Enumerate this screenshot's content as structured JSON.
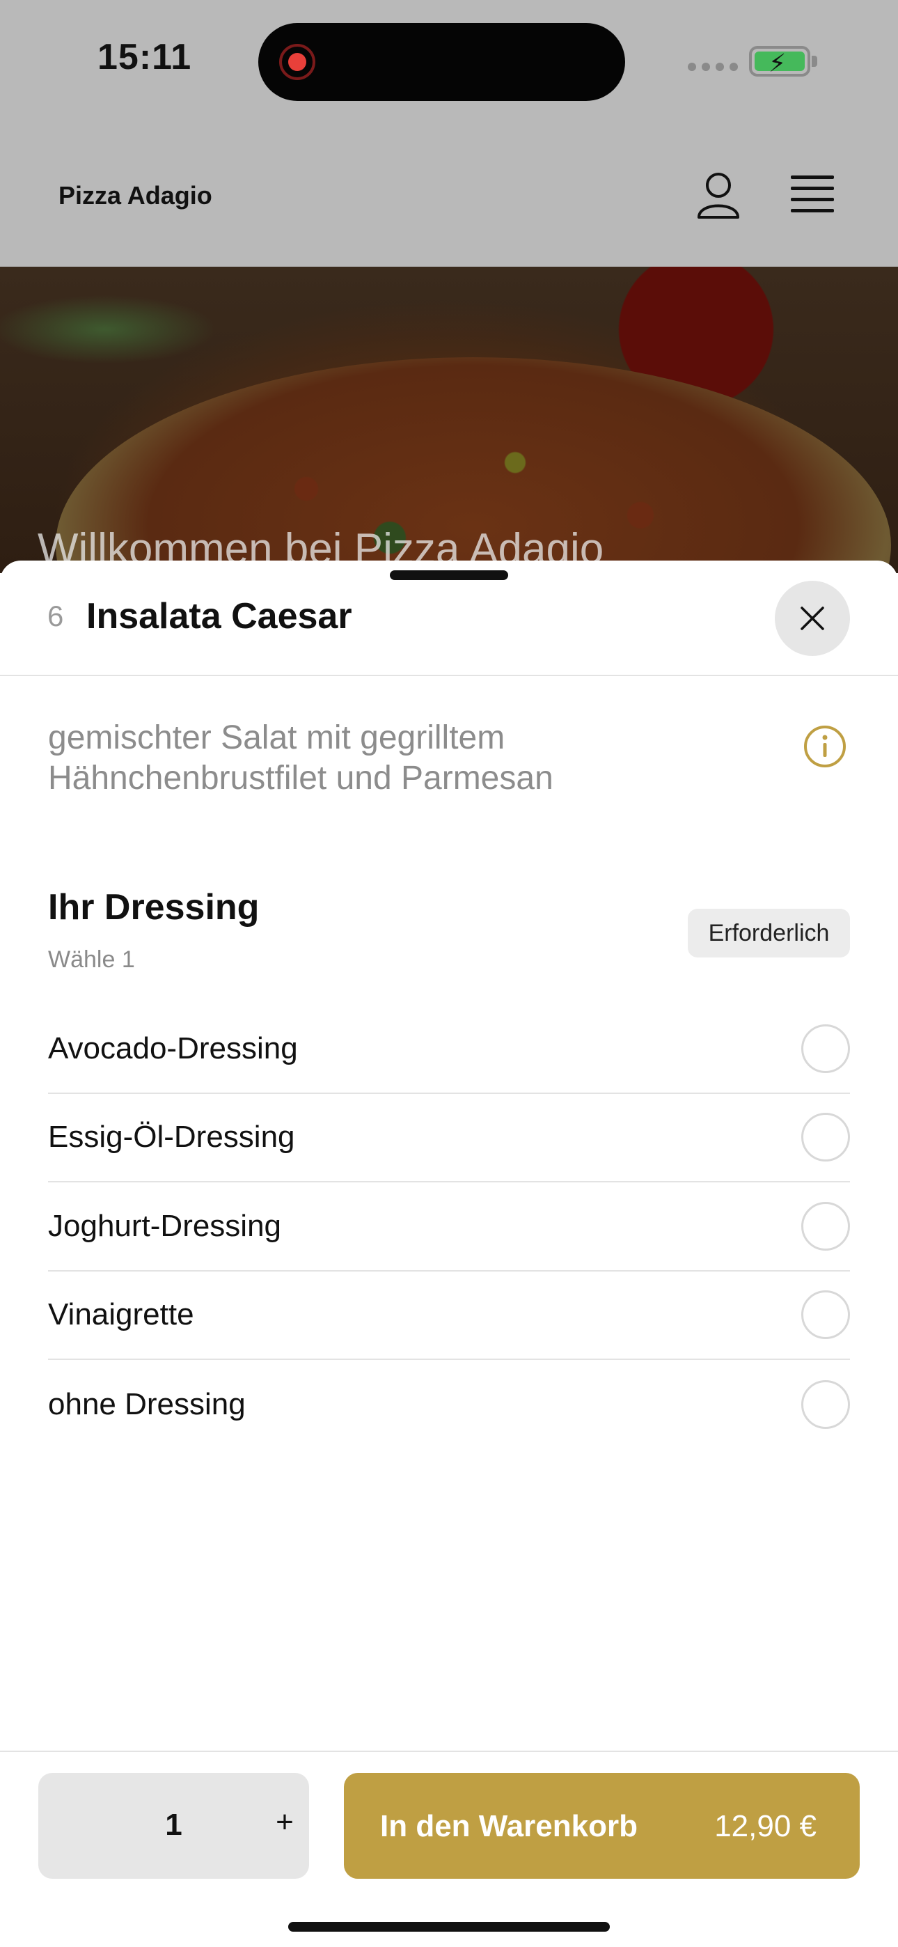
{
  "status_bar": {
    "time": "15:11"
  },
  "header": {
    "brand": "Pizza Adagio"
  },
  "hero": {
    "title": "Willkommen bei Pizza Adagio"
  },
  "item": {
    "number": "6",
    "title": "Insalata Caesar",
    "description": "gemischter Salat mit gegrilltem Hähnchenbrustfilet und Parmesan"
  },
  "option_group": {
    "title": "Ihr Dressing",
    "subtitle": "Wähle 1",
    "badge": "Erforderlich",
    "options": [
      {
        "label": "Avocado-Dressing"
      },
      {
        "label": "Essig-Öl-Dressing"
      },
      {
        "label": "Joghurt-Dressing"
      },
      {
        "label": "Vinaigrette"
      },
      {
        "label": "ohne Dressing"
      }
    ]
  },
  "cart": {
    "quantity": "1",
    "plus_label": "+",
    "button_label": "In den Warenkorb",
    "price": "12,90 €"
  },
  "colors": {
    "accent": "#bf9f43",
    "overlay": "#b9b9b9",
    "recording": "#e8403a",
    "battery": "#45b95b"
  },
  "icons": {
    "user": "user-icon",
    "menu": "menu-icon",
    "close": "close-icon",
    "info": "info-icon"
  }
}
